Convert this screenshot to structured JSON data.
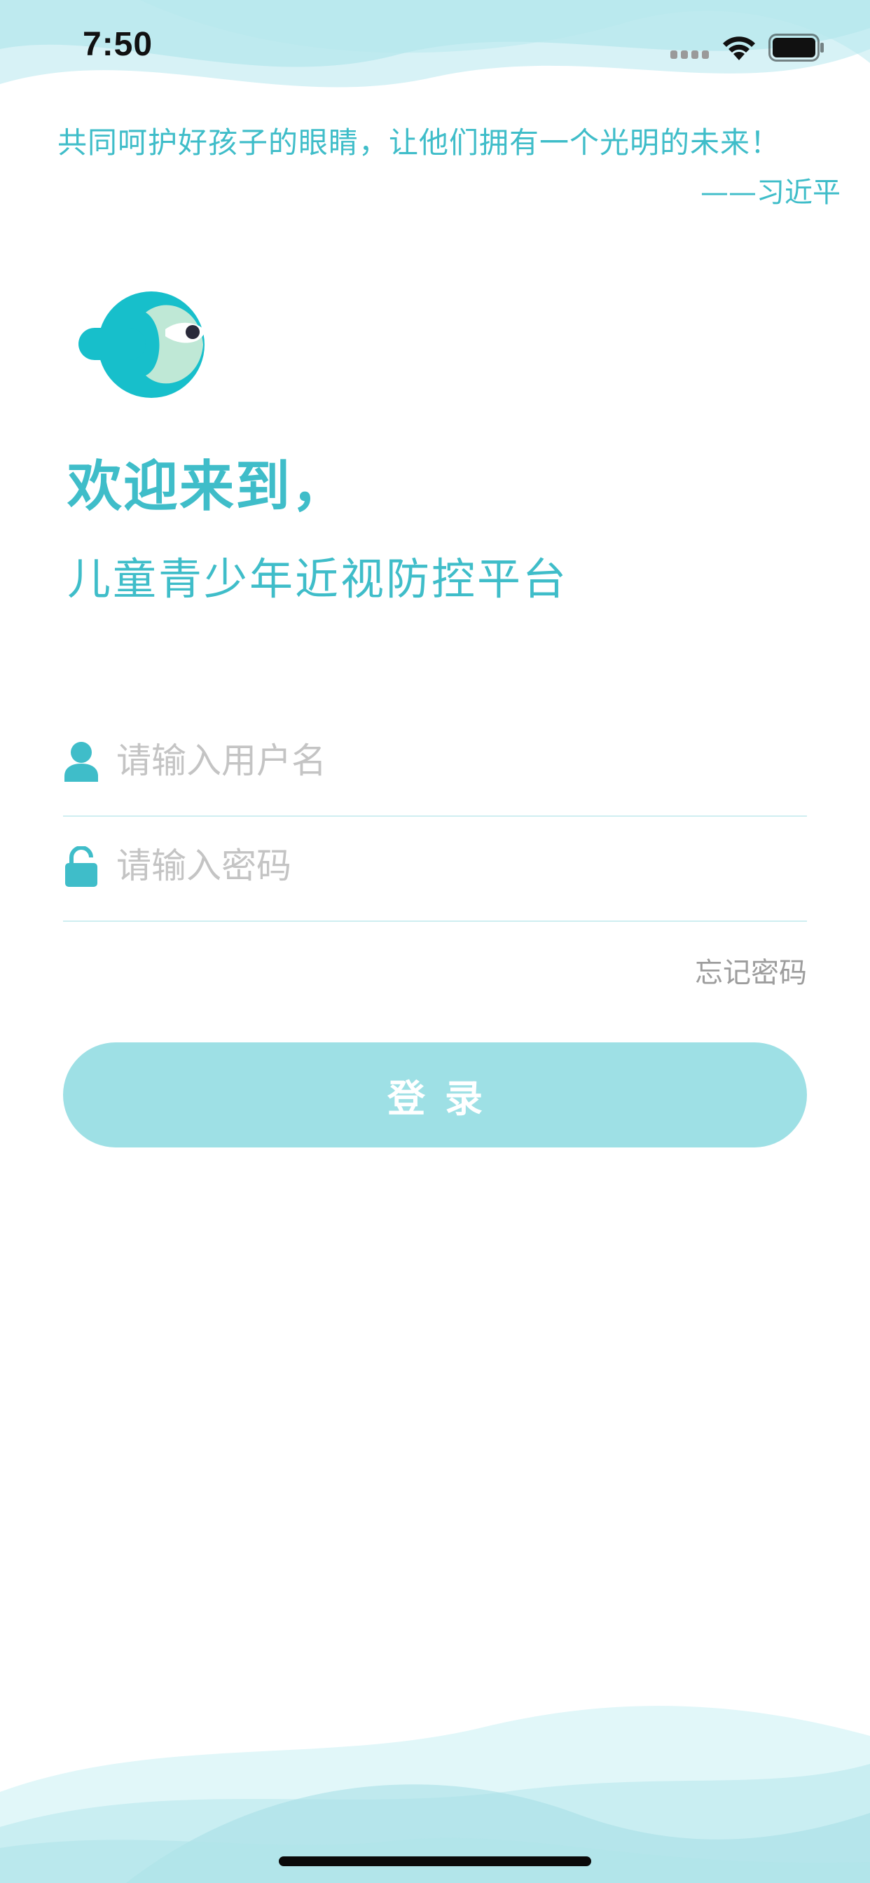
{
  "status_bar": {
    "time": "7:50"
  },
  "quote": {
    "text": "共同呵护好孩子的眼睛，让他们拥有一个光明的未来！",
    "author": "——习近平"
  },
  "welcome": {
    "title": "欢迎来到，",
    "subtitle": "儿童青少年近视防控平台"
  },
  "form": {
    "username": {
      "value": "",
      "placeholder": "请输入用户名"
    },
    "password": {
      "value": "",
      "placeholder": "请输入密码"
    },
    "forgot_password_label": "忘记密码",
    "login_label": "登录"
  },
  "icons": {
    "logo": "fish-eye-logo",
    "username": "user-icon",
    "password": "lock-icon",
    "signal": "signal-icon",
    "wifi": "wifi-icon",
    "battery": "battery-icon"
  },
  "colors": {
    "accent": "#3fbdc9",
    "button": "#9ee0e5",
    "placeholder": "#c4c4c4",
    "divider": "#cfeef1",
    "muted_text": "#9d9d9d"
  }
}
